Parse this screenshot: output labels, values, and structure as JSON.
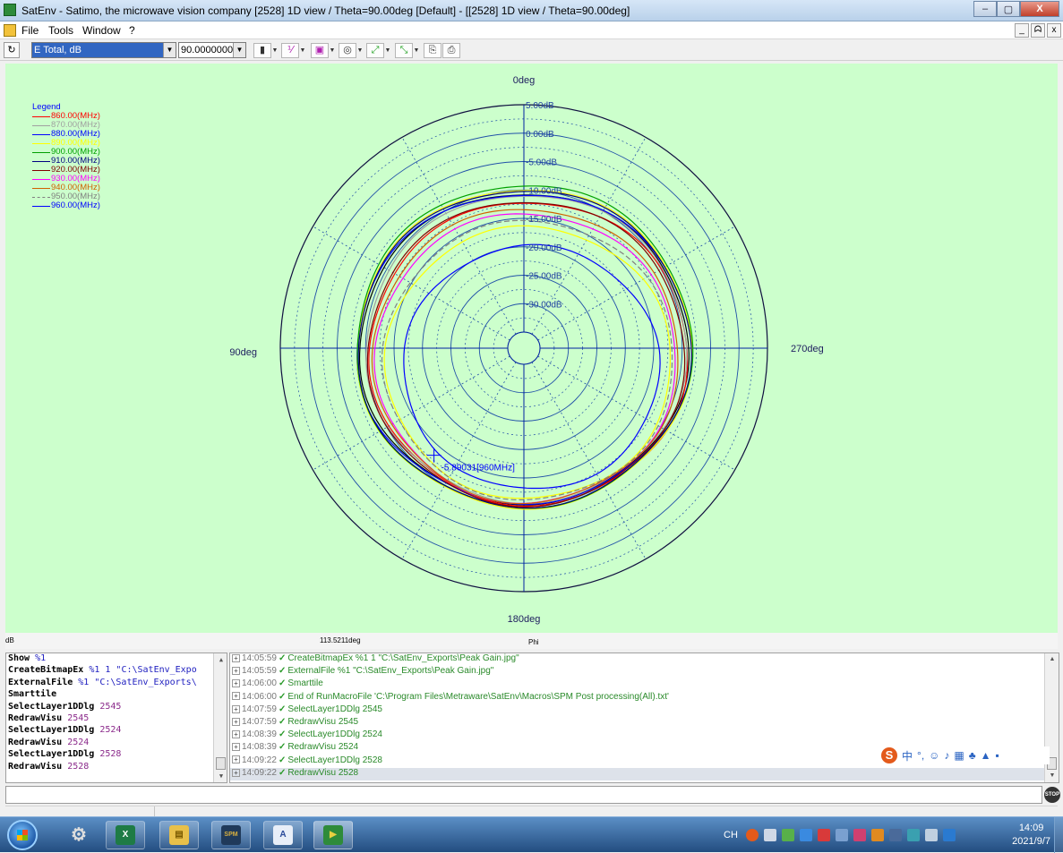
{
  "window": {
    "title": "SatEnv - Satimo, the microwave vision company [2528] 1D view / Theta=90.00deg [Default] - [[2528] 1D view / Theta=90.00deg]",
    "minimize": "–",
    "maximize": "▢",
    "close": "X"
  },
  "menu": {
    "items": [
      "File",
      "Tools",
      "Window",
      "?"
    ],
    "mdi_buttons": [
      "_",
      "ᗣ",
      "x"
    ]
  },
  "toolbar": {
    "field_combo": "E Total, dB",
    "theta_combo": "90.0000000"
  },
  "chart_data": {
    "type": "polar-line",
    "title": "",
    "angle_labels": [
      "0deg",
      "270deg",
      "180deg",
      "90deg"
    ],
    "radial_labels": [
      "5.00dB",
      "0.00dB",
      "-5.00dB",
      "-10.00dB",
      "-15.00dB",
      "-20.00dB",
      "-25.00dB",
      "-30.00dB"
    ],
    "rlim": [
      -35,
      5
    ],
    "rtick_step": 5,
    "angle_tick_step_deg": 30,
    "legend_title": "Legend",
    "legend_position": "top-left",
    "series": [
      {
        "name": "860.00(MHz)",
        "color": "#ff0000",
        "dash": false,
        "gain_dB": -11.2,
        "rx_scale": 1.05,
        "ry_scale": 1.0,
        "dx": 0.02,
        "dy": -0.02
      },
      {
        "name": "870.00(MHz)",
        "color": "#a0a0a0",
        "dash": false,
        "gain_dB": -10.5,
        "rx_scale": 1.03,
        "ry_scale": 0.99,
        "dx": 0.01,
        "dy": 0.0
      },
      {
        "name": "880.00(MHz)",
        "color": "#0000ff",
        "dash": false,
        "gain_dB": -10.1,
        "rx_scale": 1.06,
        "ry_scale": 0.98,
        "dx": 0.0,
        "dy": 0.0
      },
      {
        "name": "890.00(MHz)",
        "color": "#ffff00",
        "dash": false,
        "gain_dB": -9.8,
        "rx_scale": 1.05,
        "ry_scale": 1.0,
        "dx": 0.0,
        "dy": 0.0
      },
      {
        "name": "900.00(MHz)",
        "color": "#00a000",
        "dash": false,
        "gain_dB": -9.5,
        "rx_scale": 1.04,
        "ry_scale": 1.0,
        "dx": 0.0,
        "dy": 0.01
      },
      {
        "name": "910.00(MHz)",
        "color": "#000080",
        "dash": false,
        "gain_dB": -9.7,
        "rx_scale": 1.04,
        "ry_scale": 0.99,
        "dx": 0.0,
        "dy": 0.0
      },
      {
        "name": "920.00(MHz)",
        "color": "#800000",
        "dash": false,
        "gain_dB": -10.8,
        "rx_scale": 1.03,
        "ry_scale": 0.99,
        "dx": 0.01,
        "dy": -0.02
      },
      {
        "name": "930.00(MHz)",
        "color": "#ff00ff",
        "dash": false,
        "gain_dB": -12.4,
        "rx_scale": 1.04,
        "ry_scale": 1.0,
        "dx": 0.01,
        "dy": -0.04
      },
      {
        "name": "940.00(MHz)",
        "color": "#d06000",
        "dash": false,
        "gain_dB": -12.0,
        "rx_scale": 1.04,
        "ry_scale": 1.0,
        "dx": 0.01,
        "dy": -0.03
      },
      {
        "name": "950.00(MHz)",
        "color": "#808080",
        "dash": true,
        "gain_dB": -13.3,
        "rx_scale": 1.04,
        "ry_scale": 1.0,
        "dx": 0.02,
        "dy": -0.05
      },
      {
        "name": "960.00(MHz)",
        "color": "#0000ff",
        "dash": false,
        "gain_dB": -16.4,
        "rx_scale": 1.05,
        "ry_scale": 1.0,
        "dx": 0.03,
        "dy": -0.08
      }
    ],
    "extra_traces": [
      {
        "color": "#000000",
        "gain_dB": -10.3,
        "rx_scale": 1.05,
        "ry_scale": 0.99,
        "dx": 0.0,
        "dy": 0.0
      },
      {
        "color": "#ffff00",
        "gain_dB": -13.9,
        "rx_scale": 1.05,
        "ry_scale": 1.0,
        "dx": 0.02,
        "dy": -0.06
      }
    ],
    "marker": {
      "label": "-5.89031[960MHz]",
      "angle_deg": 220,
      "gain_dB": -5.89
    }
  },
  "statusbar": {
    "unit": "dB",
    "angle_readout": "113.5211deg",
    "axis": "Phi"
  },
  "log_left": [
    {
      "cmd": "Show",
      "arg": "%1",
      "num": ""
    },
    {
      "cmd": "CreateBitmapEx",
      "arg": "%1 1 \"C:\\SatEnv_Expo",
      "num": ""
    },
    {
      "cmd": "ExternalFile",
      "arg": "%1 \"C:\\SatEnv_Exports\\",
      "num": ""
    },
    {
      "cmd": "Smarttile",
      "arg": "",
      "num": ""
    },
    {
      "cmd": "SelectLayer1DDlg",
      "arg": "",
      "num": "2545"
    },
    {
      "cmd": "RedrawVisu",
      "arg": "",
      "num": "2545"
    },
    {
      "cmd": "SelectLayer1DDlg",
      "arg": "",
      "num": "2524"
    },
    {
      "cmd": "RedrawVisu",
      "arg": "",
      "num": "2524"
    },
    {
      "cmd": "SelectLayer1DDlg",
      "arg": "",
      "num": "2528"
    },
    {
      "cmd": "RedrawVisu",
      "arg": "",
      "num": "2528"
    }
  ],
  "log_right": [
    {
      "time": "14:05:59",
      "text": "CreateBitmapEx %1 1 \"C:\\SatEnv_Exports\\Peak Gain.jpg\""
    },
    {
      "time": "14:05:59",
      "text": "ExternalFile %1 \"C:\\SatEnv_Exports\\Peak Gain.jpg\""
    },
    {
      "time": "14:06:00",
      "text": "Smarttile"
    },
    {
      "time": "14:06:00",
      "text": "End of RunMacroFile 'C:\\Program Files\\Metraware\\SatEnv\\Macros\\SPM Post processing(All).txt'"
    },
    {
      "time": "14:07:59",
      "text": "SelectLayer1DDlg 2545"
    },
    {
      "time": "14:07:59",
      "text": "RedrawVisu 2545"
    },
    {
      "time": "14:08:39",
      "text": "SelectLayer1DDlg 2524"
    },
    {
      "time": "14:08:39",
      "text": "RedrawVisu 2524"
    },
    {
      "time": "14:09:22",
      "text": "SelectLayer1DDlg 2528"
    },
    {
      "time": "14:09:22",
      "text": "RedrawVisu 2528"
    }
  ],
  "ime": {
    "logo": "S",
    "glyphs": [
      "中",
      "°,",
      "☺",
      "♪",
      "▦",
      "♣",
      "▲",
      "▪"
    ]
  },
  "stop": {
    "label": "STOP"
  },
  "taskbar": {
    "apps": [
      {
        "name": "settings",
        "label": "⚙"
      },
      {
        "name": "excel",
        "label": "X"
      },
      {
        "name": "explorer",
        "label": "▤"
      },
      {
        "name": "spm",
        "label": "SPM"
      },
      {
        "name": "editor",
        "label": "A"
      },
      {
        "name": "satenv",
        "label": "▶"
      }
    ],
    "lang": "CH",
    "time": "14:09",
    "date": "2021/9/7"
  },
  "colors": {
    "chart_bg": "#ccffcc",
    "grid": "#2050a8",
    "axis": "#0020a0",
    "outer_circle": "#101040"
  }
}
